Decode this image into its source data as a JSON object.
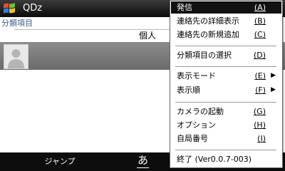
{
  "title_bar": {
    "app_title": "QDz"
  },
  "category": {
    "label": "分類項目",
    "value": "個人"
  },
  "softkeys": {
    "left": "ジャンプ",
    "ime": "あ"
  },
  "menu": {
    "items": [
      {
        "label": "発信",
        "accel": "(A)",
        "selected": true
      },
      {
        "label": "連絡先の詳細表示",
        "accel": "(B)"
      },
      {
        "label": "連絡先の新規追加",
        "accel": "(C)"
      },
      {
        "label": "分類項目の選択",
        "accel": "(D)"
      },
      {
        "label": "表示モード",
        "accel": "(E)",
        "submenu": true
      },
      {
        "label": "表示順",
        "accel": "(F)",
        "submenu": true
      },
      {
        "label": "カメラの起動",
        "accel": "(G)"
      },
      {
        "label": "オプション",
        "accel": "(H)"
      },
      {
        "label": "自局番号",
        "accel": "(I)"
      },
      {
        "label": "終了 (Ver0.0.7-003)"
      }
    ]
  },
  "colors": {
    "title_bar": "#1a1a1a",
    "menu_highlight": "#111111",
    "contact_band": "#7a7a7a",
    "category_text": "#3b5b8a"
  }
}
